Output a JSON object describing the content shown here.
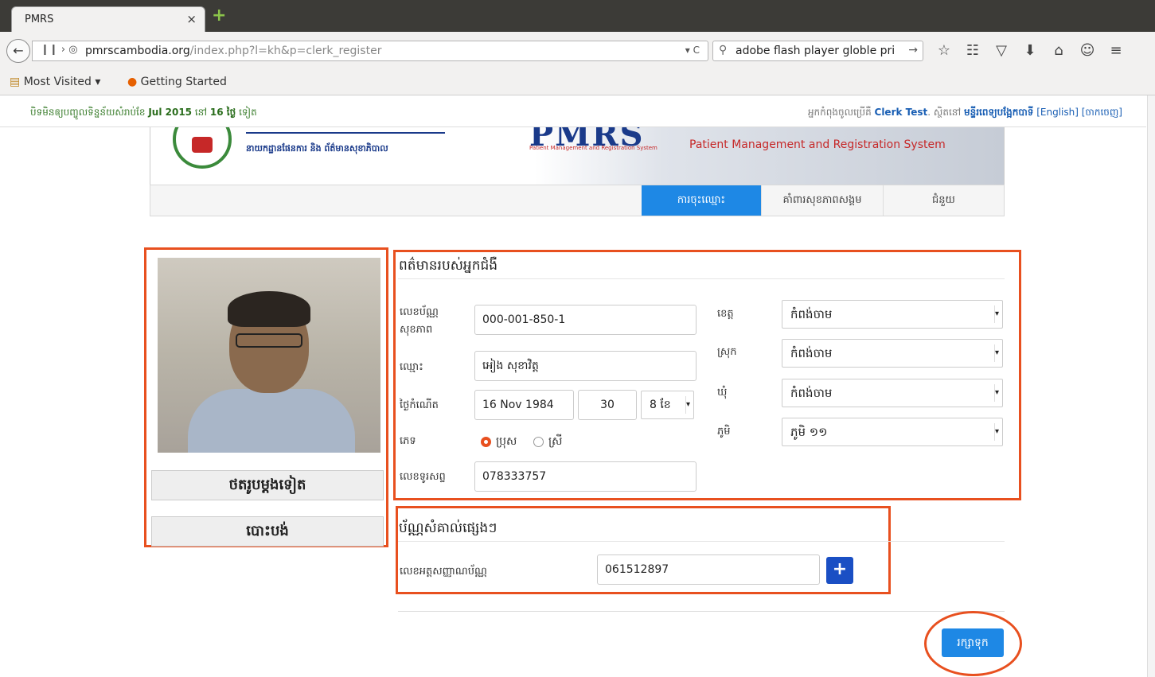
{
  "browser": {
    "tab_title": "PMRS",
    "tab_close": "×",
    "new_tab": "+",
    "url_host": "pmrscambodia.org",
    "url_path": "/index.php?l=kh&p=clerk_register",
    "url_right": "▾ C",
    "search_text": "adobe flash player globle pri",
    "search_go": "→",
    "toolbar_icons": [
      "star-icon",
      "reading-list-icon",
      "pocket-icon",
      "download-icon",
      "home-icon",
      "chat-icon",
      "menu-icon"
    ],
    "bookmarks": [
      "Most Visited ▾",
      "Getting Started"
    ]
  },
  "infobar": {
    "left_prefix": " បិទមិនឲ្យបញ្ចូលទិន្នន័យសំរាប់ខែ",
    "month": "Jul 2015",
    "left_mid": "នៅ",
    "days": "16 ថ្ងៃ",
    "left_suffix": "ទៀត",
    "right_prefix": "អ្នកកំពុងចូលប្រើគឺ",
    "user": "Clerk Test",
    "right_mid": ". ស្ថិតនៅ",
    "facility": "មន្ទីរពេទ្យបង្អែកបាទី",
    "lang_link": "[English]",
    "logout_link": "[ចាកចេញ]"
  },
  "banner": {
    "department": "នាយកដ្ឋានផែនការ និង ព័ត៌មានសុខាភិបាល",
    "logo_text": "PMRS",
    "logo_sub": "Patient Management and Registration System",
    "title": "Patient Management and Registration System"
  },
  "menu": {
    "items": [
      "ការចុះឈ្មោះ",
      "គាំពារសុខភាពសង្គម",
      "ជំនួយ"
    ]
  },
  "photo_panel": {
    "retake_button": "ថតរូបម្តងទៀត",
    "cancel_button": "បោះបង់"
  },
  "patient_info": {
    "section_title": "ពត៌មានរបស់អ្នកជំងឺ",
    "health_id_label_1": "លេខប័ណ្ណ",
    "health_id_label_2": "សុខភាព",
    "health_id_value": "000-001-850-1",
    "name_label": "ឈ្មោះ",
    "name_value": "អៀង សុខាវិត្ត",
    "dob_label": "ថ្ងៃកំណើត",
    "dob_value": "16 Nov 1984",
    "age_value": "30",
    "age_unit": "8 ខែ",
    "sex_label": "ភេទ",
    "sex_male": "ប្រុស",
    "sex_female": "ស្រី",
    "phone_label": "លេខទូរសព្ទ",
    "phone_value": "078333757",
    "province_label": "ខេត្ត",
    "province_value": "កំពង់ចាម",
    "district_label": "ស្រុក",
    "district_value": "កំពង់ចាម",
    "commune_label": "ឃុំ",
    "commune_value": "កំពង់ចាម",
    "village_label": "ភូមិ",
    "village_value": "ភូមិ ១១"
  },
  "other_ids": {
    "section_title": "ប័ណ្ណសំគាល់ផ្សេងៗ",
    "id_label": "លេខអត្តសញ្ញាណប័ណ្ណ",
    "id_value": "061512897",
    "add_button": "+"
  },
  "save_button": "រក្សាទុក",
  "colors": {
    "highlight": "#e8501f",
    "primary": "#1e88e5",
    "add_button": "#1a4fc4"
  }
}
